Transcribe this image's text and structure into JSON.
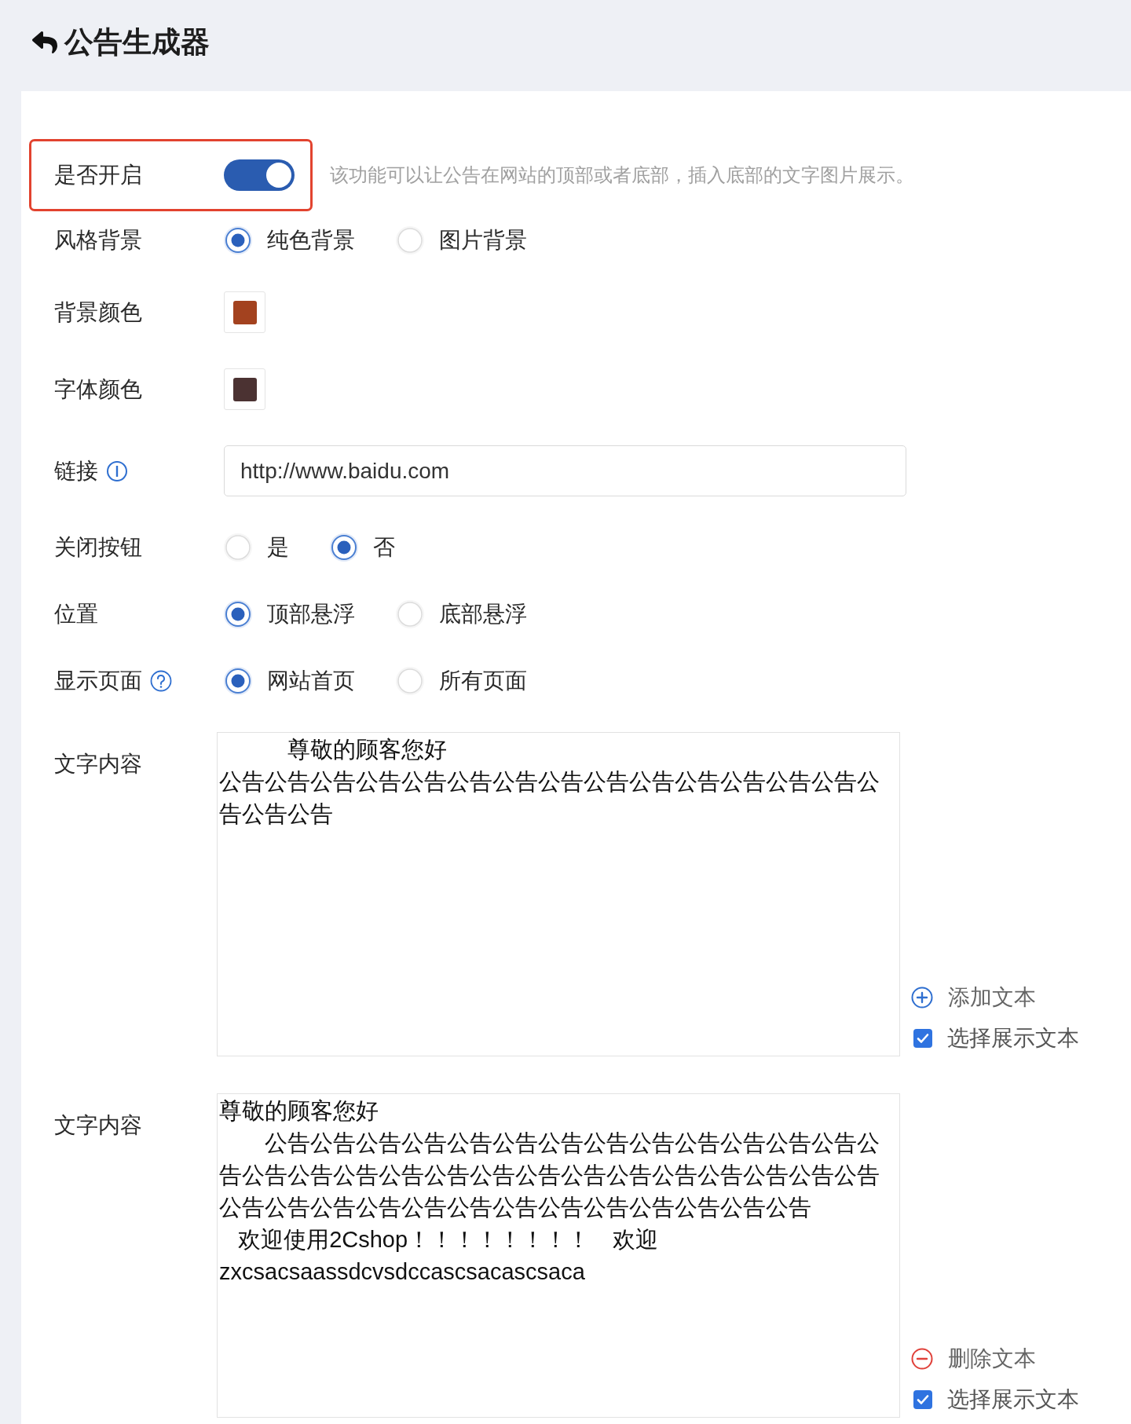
{
  "header": {
    "title": "公告生成器"
  },
  "rows": [
    {
      "kind": "toggle",
      "label": "是否开启",
      "on": true,
      "highlighted": true,
      "hint": "该功能可以让公告在网站的顶部或者底部，插入底部的文字图片展示。"
    },
    {
      "kind": "radio",
      "label": "风格背景",
      "options": [
        {
          "label": "纯色背景",
          "selected": true
        },
        {
          "label": "图片背景",
          "selected": false
        }
      ]
    },
    {
      "kind": "color",
      "label": "背景颜色",
      "color": "#a3421f"
    },
    {
      "kind": "color",
      "label": "字体颜色",
      "color": "#4b3232"
    },
    {
      "kind": "input",
      "label": "链接",
      "tip": {
        "kind": "info"
      },
      "value": "http://www.baidu.com"
    },
    {
      "kind": "radio",
      "label": "关闭按钮",
      "options": [
        {
          "label": "是",
          "selected": false
        },
        {
          "label": "否",
          "selected": true
        }
      ]
    },
    {
      "kind": "radio",
      "label": "位置",
      "options": [
        {
          "label": "顶部悬浮",
          "selected": true
        },
        {
          "label": "底部悬浮",
          "selected": false
        }
      ]
    },
    {
      "kind": "radio",
      "label": "显示页面",
      "tip": {
        "kind": "question"
      },
      "options": [
        {
          "label": "网站首页",
          "selected": true
        },
        {
          "label": "所有页面",
          "selected": false
        }
      ]
    },
    {
      "kind": "textarea",
      "label": "文字内容",
      "lines": [
        "　　　尊敬的顾客您好",
        "公告公告公告公告公告公告公告公告公告公告公告公告公告公告公",
        "告公告公告"
      ],
      "action": {
        "kind": "add",
        "label": "添加文本"
      },
      "display": {
        "label": "选择展示文本",
        "checked": true
      }
    },
    {
      "kind": "textarea",
      "label": "文字内容",
      "lines": [
        "尊敬的顾客您好",
        "　　公告公告公告公告公告公告公告公告公告公告公告公告公告公",
        "告公告公告公告公告公告公告公告公告公告公告公告公告公告公告",
        "公告公告公告公告公告公告公告公告公告公告公告公告公告",
        "   欢迎使用2Cshop！！！！！！！！　欢迎",
        "zxcsacsaassdcvsdccascsacascsaca"
      ],
      "action": {
        "kind": "remove",
        "label": "删除文本"
      },
      "display": {
        "label": "选择展示文本",
        "checked": true
      }
    }
  ]
}
